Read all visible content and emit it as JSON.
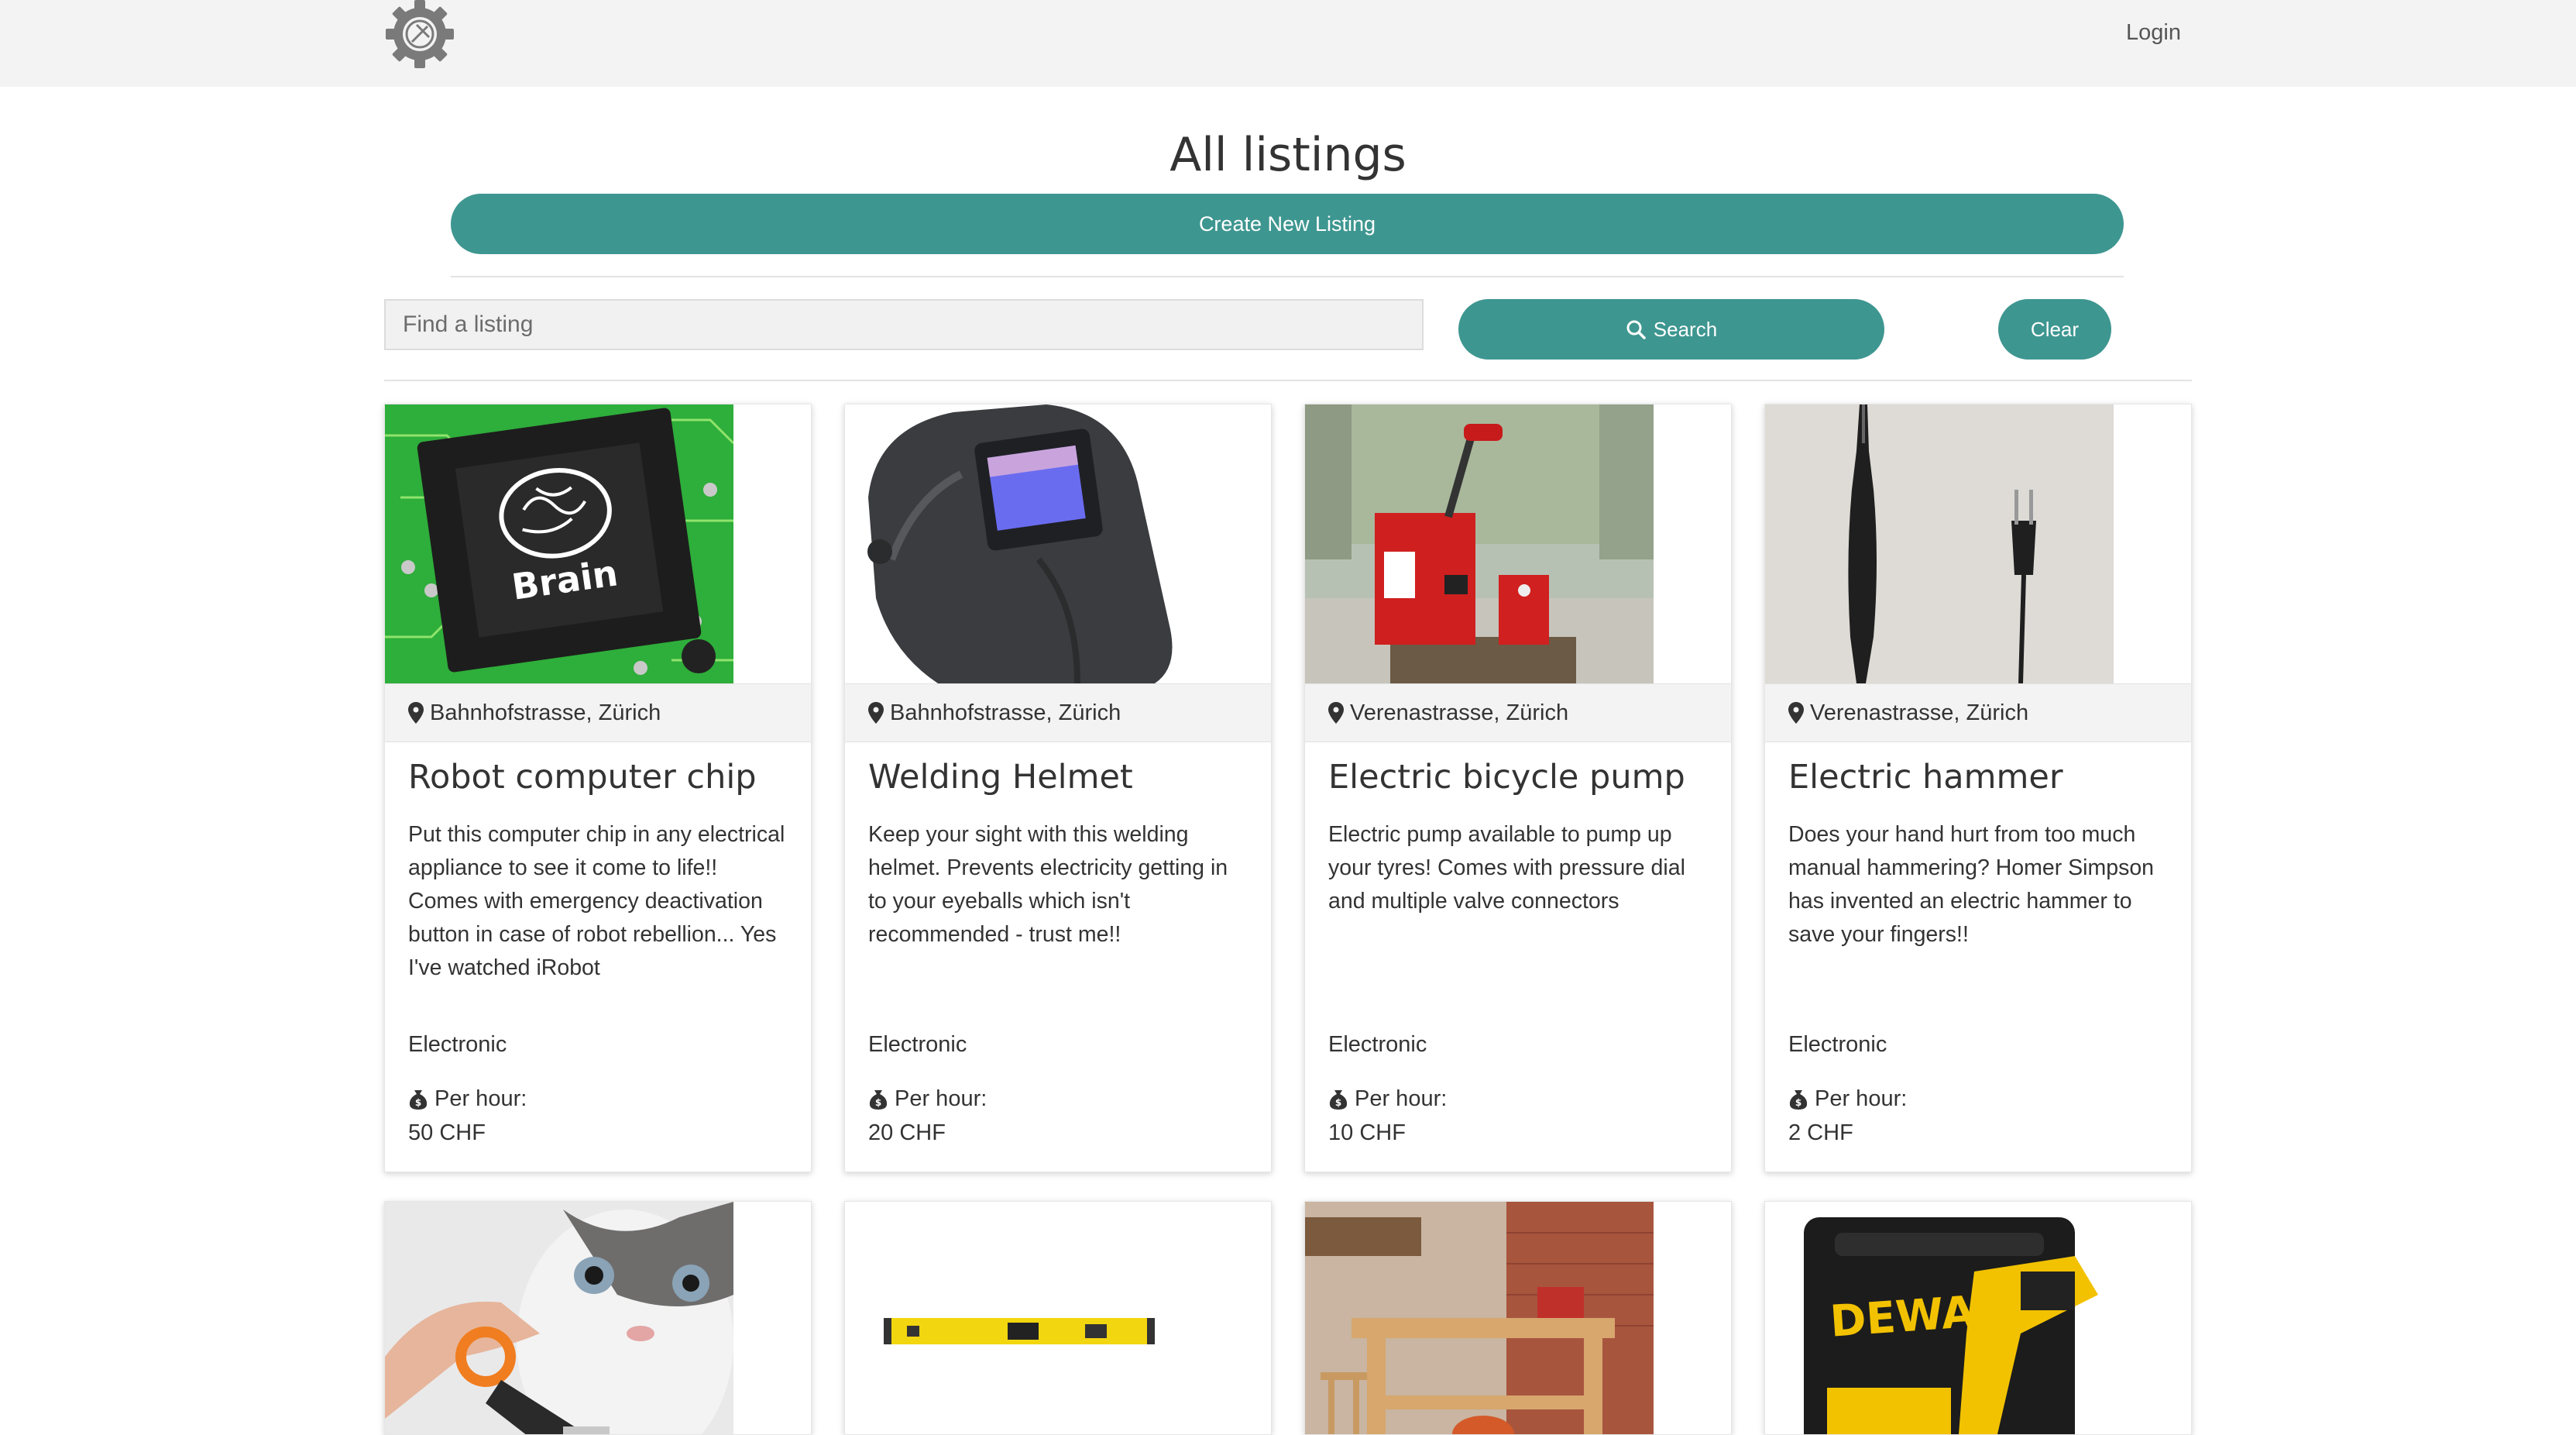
{
  "nav": {
    "login_label": "Login"
  },
  "page": {
    "title": "All listings",
    "create_label": "Create New Listing",
    "search_placeholder": "Find a listing",
    "search_label": "Search",
    "clear_label": "Clear"
  },
  "listings": [
    {
      "location": "Bahnhofstrasse, Zürich",
      "title": "Robot computer chip",
      "description": "Put this computer chip in any electrical appliance to see it come to life!! Comes with emergency deactivation button in case of robot rebellion... Yes I've watched iRobot",
      "category": "Electronic",
      "rate_label": "Per hour:",
      "price": "50 CHF",
      "image_text": "Brain"
    },
    {
      "location": "Bahnhofstrasse, Zürich",
      "title": "Welding Helmet",
      "description": "Keep your sight with this welding helmet. Prevents electricity getting in to your eyeballs which isn't recommended - trust me!!",
      "category": "Electronic",
      "rate_label": "Per hour:",
      "price": "20 CHF"
    },
    {
      "location": "Verenastrasse, Zürich",
      "title": "Electric bicycle pump",
      "description": "Electric pump available to pump up your tyres! Comes with pressure dial and multiple valve connectors",
      "category": "Electronic",
      "rate_label": "Per hour:",
      "price": "10 CHF"
    },
    {
      "location": "Verenastrasse, Zürich",
      "title": "Electric hammer",
      "description": "Does your hand hurt from too much manual hammering? Homer Simpson has invented an electric hammer to save your fingers!!",
      "category": "Electronic",
      "rate_label": "Per hour:",
      "price": "2 CHF"
    },
    {},
    {},
    {},
    {
      "image_text": "DEWALT"
    }
  ]
}
